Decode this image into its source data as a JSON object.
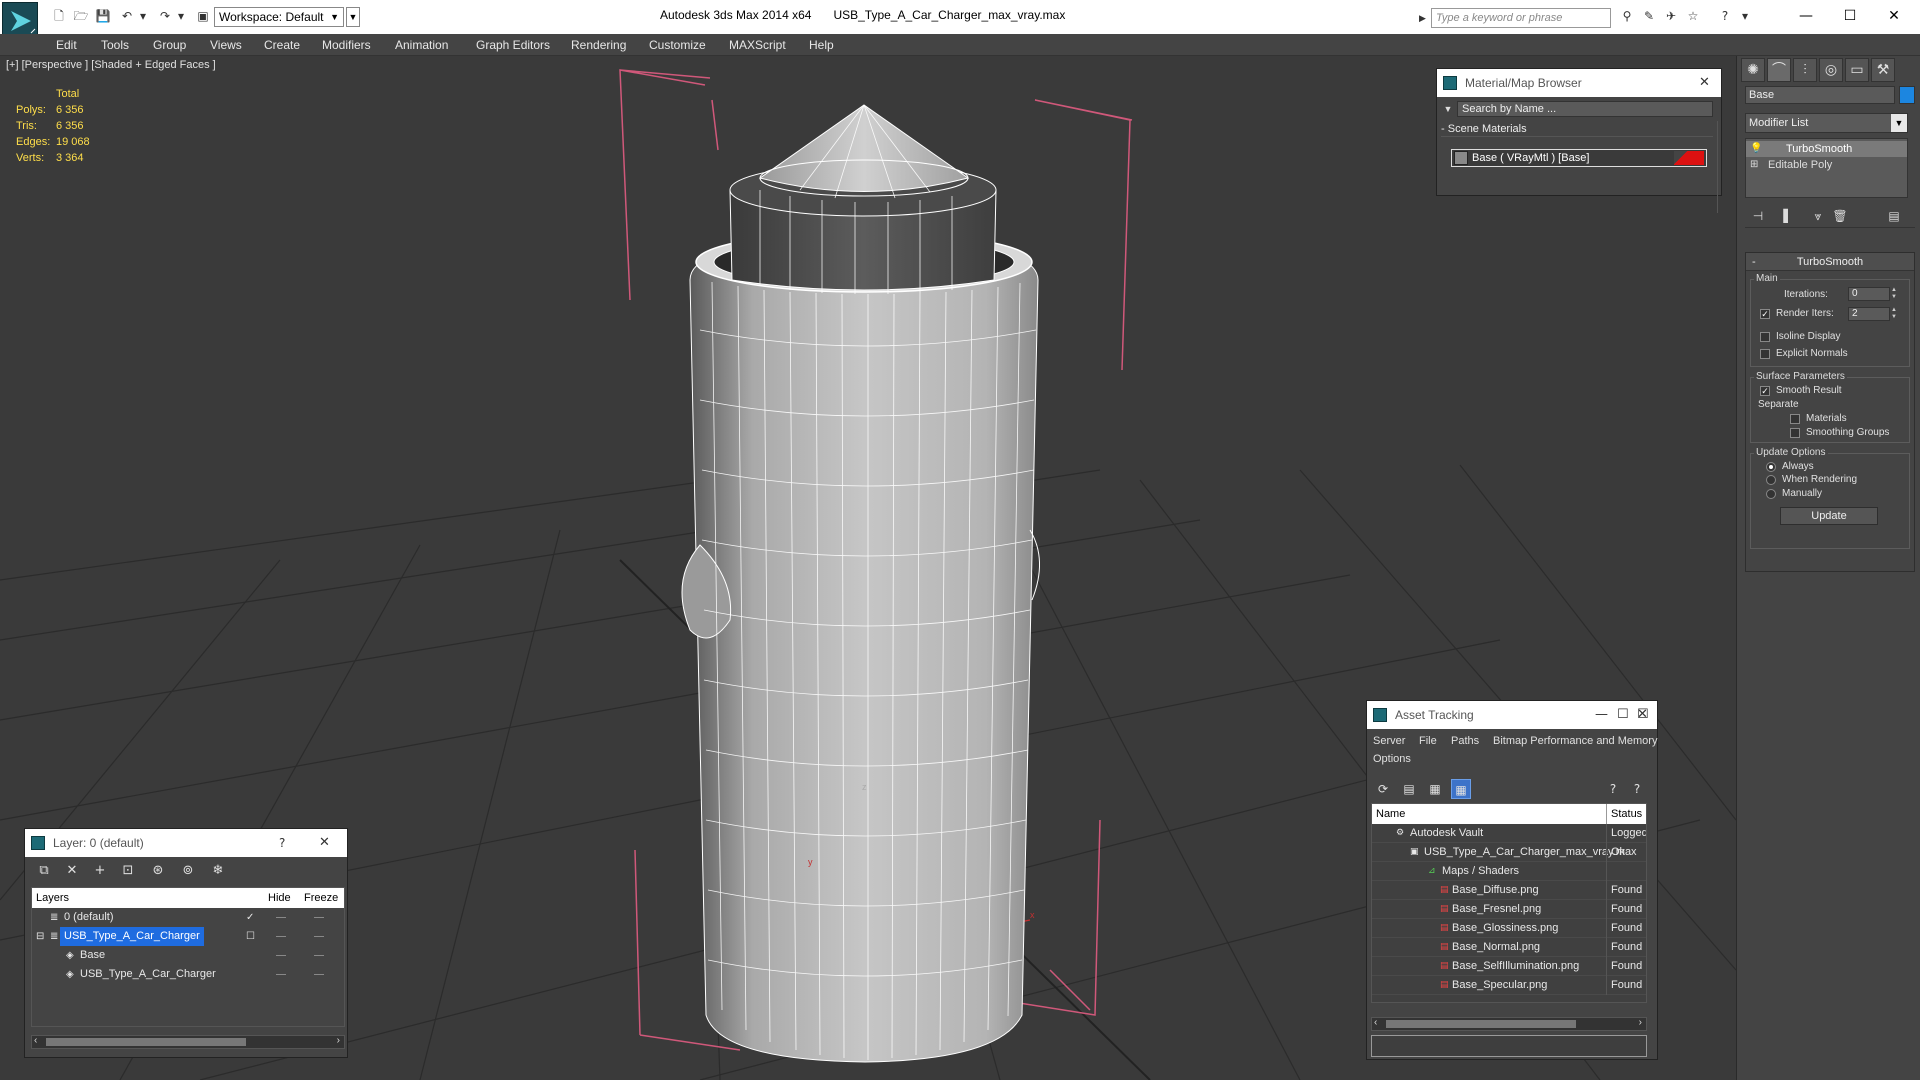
{
  "titlebar": {
    "workspace": "Workspace: Default",
    "app_title": "Autodesk 3ds Max  2014 x64",
    "file_name": "USB_Type_A_Car_Charger_max_vray.max",
    "search_placeholder": "Type a keyword or phrase"
  },
  "menubar": {
    "items": [
      "Edit",
      "Tools",
      "Group",
      "Views",
      "Create",
      "Modifiers",
      "Animation",
      "Graph Editors",
      "Rendering",
      "Customize",
      "MAXScript",
      "Help"
    ]
  },
  "viewport": {
    "label": "[+] [Perspective ] [Shaded + Edged Faces ]",
    "stats": {
      "header": "Total",
      "rows": [
        {
          "key": "Polys:",
          "value": "6 356"
        },
        {
          "key": "Tris:",
          "value": "6 356"
        },
        {
          "key": "Edges:",
          "value": "19 068"
        },
        {
          "key": "Verts:",
          "value": "3 364"
        }
      ]
    }
  },
  "command_panel": {
    "object_name": "Base",
    "object_color": "#1c86e0",
    "modifier_list": "Modifier List",
    "stack": [
      {
        "label": "TurboSmooth",
        "selected": true
      },
      {
        "label": "Editable Poly",
        "selected": false
      }
    ],
    "turbosmooth": {
      "title": "TurboSmooth",
      "main_group": "Main",
      "iterations_label": "Iterations:",
      "iterations_value": "0",
      "render_iters_label": "Render Iters:",
      "render_iters_value": "2",
      "render_iters_checked": true,
      "isoline_label": "Isoline Display",
      "explicit_normals_label": "Explicit Normals",
      "surface_group": "Surface Parameters",
      "smooth_result_label": "Smooth Result",
      "separate_label": "Separate",
      "materials_label": "Materials",
      "smoothing_groups_label": "Smoothing Groups",
      "update_group": "Update Options",
      "always_label": "Always",
      "when_rendering_label": "When Rendering",
      "manually_label": "Manually",
      "update_button": "Update"
    }
  },
  "material_browser": {
    "title": "Material/Map Browser",
    "search_placeholder": "Search by Name ...",
    "group": "Scene Materials",
    "item": "Base  ( VRayMtl )  [Base]"
  },
  "asset_tracking": {
    "title": "Asset Tracking",
    "menu": [
      "Server",
      "File",
      "Paths",
      "Bitmap Performance and Memory",
      "Options"
    ],
    "columns": [
      "Name",
      "Status"
    ],
    "rows": [
      {
        "name": "Autodesk Vault",
        "status": "Logged C",
        "indent": 1,
        "icon": "vault-icon"
      },
      {
        "name": "USB_Type_A_Car_Charger_max_vray.max",
        "status": "Ok",
        "indent": 2,
        "icon": "max-file-icon"
      },
      {
        "name": "Maps / Shaders",
        "status": "",
        "indent": 3,
        "icon": "maps-icon"
      },
      {
        "name": "Base_Diffuse.png",
        "status": "Found",
        "indent": 4,
        "icon": "png-icon"
      },
      {
        "name": "Base_Fresnel.png",
        "status": "Found",
        "indent": 4,
        "icon": "png-icon"
      },
      {
        "name": "Base_Glossiness.png",
        "status": "Found",
        "indent": 4,
        "icon": "png-icon"
      },
      {
        "name": "Base_Normal.png",
        "status": "Found",
        "indent": 4,
        "icon": "png-icon"
      },
      {
        "name": "Base_SelfIllumination.png",
        "status": "Found",
        "indent": 4,
        "icon": "png-icon"
      },
      {
        "name": "Base_Specular.png",
        "status": "Found",
        "indent": 4,
        "icon": "png-icon"
      }
    ]
  },
  "layer_window": {
    "title": "Layer: 0 (default)",
    "help": "?",
    "columns": [
      "Layers",
      "Hide",
      "Freeze"
    ],
    "rows": [
      {
        "name": "0 (default)",
        "indent": 1,
        "selected": false
      },
      {
        "name": "USB_Type_A_Car_Charger",
        "indent": 1,
        "selected": true
      },
      {
        "name": "Base",
        "indent": 2,
        "selected": false
      },
      {
        "name": "USB_Type_A_Car_Charger",
        "indent": 2,
        "selected": false
      }
    ]
  }
}
